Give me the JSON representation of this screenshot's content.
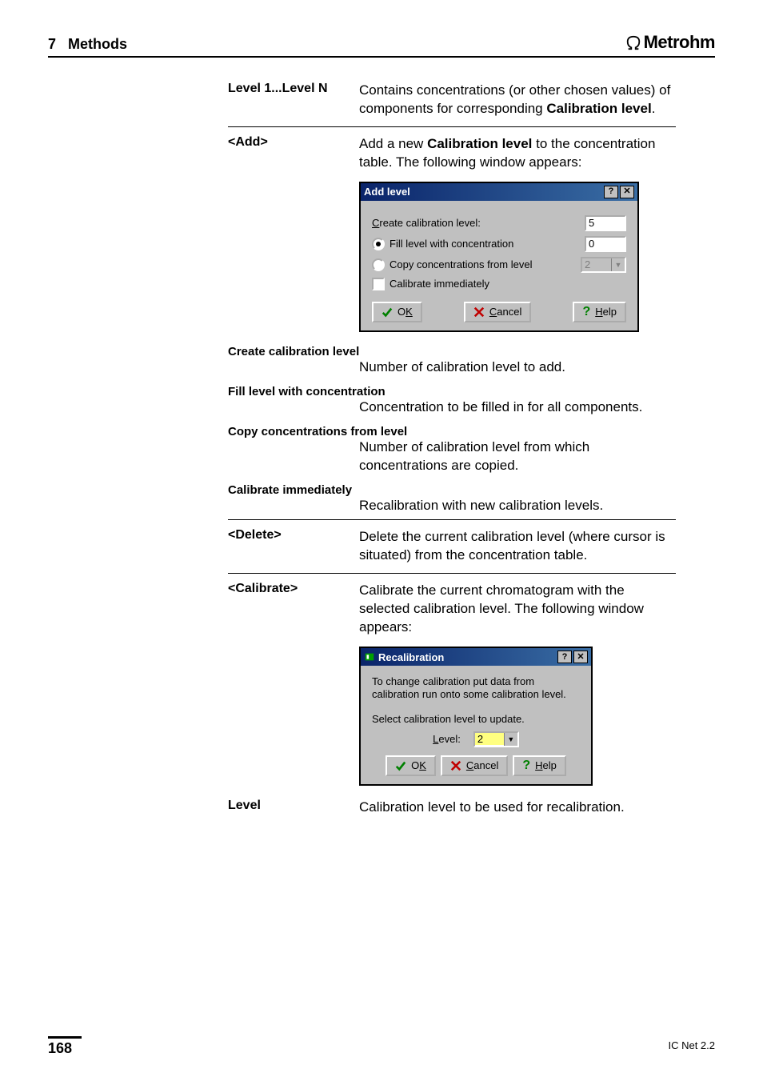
{
  "header": {
    "chapter_number": "7",
    "chapter_title": "Methods",
    "brand": "Metrohm"
  },
  "rows": {
    "level_range": {
      "label": "Level 1...Level N",
      "body_pre": "Contains concentrations (or other chosen values) of components for corresponding ",
      "body_bold": "Calibration level",
      "body_post": "."
    },
    "add": {
      "label": "<Add>",
      "body_pre": "Add a new ",
      "body_bold": "Calibration level",
      "body_post": " to the concentration table. The following window appears:"
    },
    "delete": {
      "label": "<Delete>",
      "body": "Delete the current calibration level (where cursor is situated) from the concentration table."
    },
    "calibrate": {
      "label": "<Calibrate>",
      "body": "Calibrate the current chromatogram with the selected calibration level. The following window appears:"
    },
    "level": {
      "label": "Level",
      "body": "Calibration level to be used for recalibration."
    }
  },
  "add_level_dialog": {
    "title": "Add level",
    "create_label_pre": "C",
    "create_label_post": "reate calibration level:",
    "create_value": "5",
    "fill_label": "Fill level with concentration",
    "fill_value": "0",
    "copy_label": "Copy concentrations from level",
    "copy_value": "2",
    "calibrate_immediately": "Calibrate immediately",
    "ok_pre": "O",
    "ok_mn": "K",
    "cancel_mn": "C",
    "cancel_post": "ancel",
    "help_mn": "H",
    "help_post": "elp"
  },
  "defs": {
    "create": {
      "h": "Create calibration level",
      "b": "Number of calibration level to add."
    },
    "fill": {
      "h": "Fill level with concentration",
      "b": "Concentration to be filled in for all components."
    },
    "copy": {
      "h": "Copy concentrations from level",
      "b": "Number of calibration level from which concentrations are copied."
    },
    "calib": {
      "h": "Calibrate immediately",
      "b": "Recalibration with new calibration levels."
    }
  },
  "recal_dialog": {
    "title": "Recalibration",
    "line1": "To change calibration put data from calibration run onto some calibration level.",
    "line2": "Select calibration level to update.",
    "level_mn": "L",
    "level_post": "evel:",
    "level_value": "2",
    "ok_pre": "O",
    "ok_mn": "K",
    "cancel_mn": "C",
    "cancel_post": "ancel",
    "help_mn": "H",
    "help_post": "elp"
  },
  "footer": {
    "page_number": "168",
    "product": "IC Net 2.2"
  }
}
